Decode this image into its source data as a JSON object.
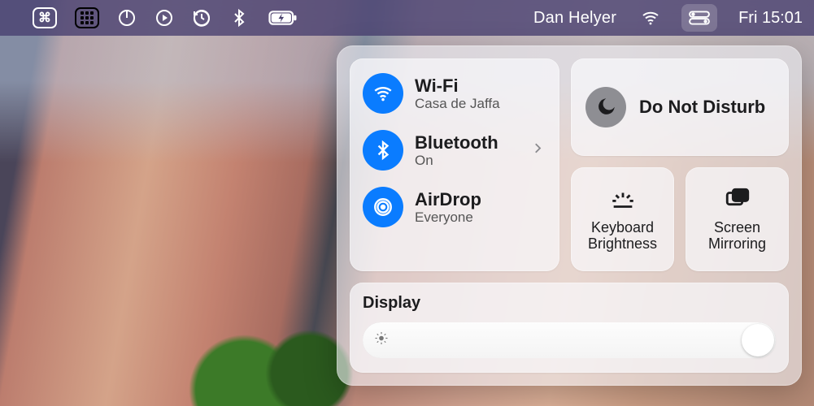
{
  "menubar": {
    "user_name": "Dan Helyer",
    "clock": "Fri 15:01",
    "icons": {
      "keyboard_shortcuts": "command-icon",
      "app_grid": "grid-icon",
      "power": "power-icon",
      "play": "play-icon",
      "time_machine": "timemachine-icon",
      "bluetooth": "bluetooth-icon",
      "battery": "battery-charging-icon",
      "wifi": "wifi-icon",
      "control_center": "control-center-icon"
    }
  },
  "control_center": {
    "connectivity": {
      "wifi": {
        "title": "Wi-Fi",
        "subtitle": "Casa de Jaffa",
        "on": true
      },
      "bluetooth": {
        "title": "Bluetooth",
        "subtitle": "On",
        "on": true,
        "has_detail": true
      },
      "airdrop": {
        "title": "AirDrop",
        "subtitle": "Everyone",
        "on": true
      }
    },
    "dnd": {
      "title": "Do Not Disturb",
      "on": false
    },
    "tiles": {
      "keyboard_brightness": "Keyboard Brightness",
      "screen_mirroring": "Screen Mirroring"
    },
    "display": {
      "title": "Display",
      "brightness_percent": 100
    }
  }
}
